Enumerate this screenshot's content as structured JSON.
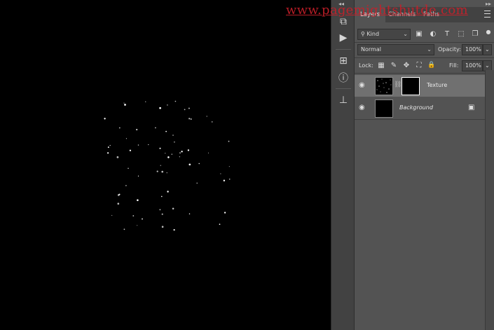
{
  "watermark": "www.pagemightshutde.com",
  "canvas": {
    "background": "#000000"
  },
  "toolstrip": {
    "collapse": "◂◂",
    "tools": [
      {
        "name": "history-icon",
        "glyph": "⧉"
      },
      {
        "name": "play-action-icon",
        "glyph": "▶"
      },
      {
        "name": "properties-icon",
        "glyph": "⊞"
      },
      {
        "name": "info-icon",
        "glyph": "ⓘ"
      },
      {
        "name": "clone-source-icon",
        "glyph": "⊥"
      }
    ]
  },
  "panel": {
    "collapse": "▸▸",
    "tabs": [
      "Layers",
      "Channels",
      "Paths"
    ],
    "active_tab": "Layers",
    "filter": {
      "label": "Kind",
      "search_glyph": "⚲"
    },
    "filter_icons": [
      "▣",
      "◐",
      "T",
      "⬚",
      "❐"
    ],
    "blend_mode": "Normal",
    "opacity_label": "Opacity:",
    "opacity_value": "100%",
    "lock_label": "Lock:",
    "lock_icons": [
      "▦",
      "✎",
      "✥",
      "⛶",
      "🔒"
    ],
    "fill_label": "Fill:",
    "fill_value": "100%",
    "layers": [
      {
        "name": "Texture",
        "visible_glyph": "👁",
        "selected": true
      },
      {
        "name": "Background",
        "visible_glyph": "👁",
        "selected": false,
        "lock_glyph": "🔒"
      }
    ]
  },
  "colors": {
    "panel_bg": "#535353",
    "selected_row": "#707070",
    "watermark": "#c8202a"
  }
}
